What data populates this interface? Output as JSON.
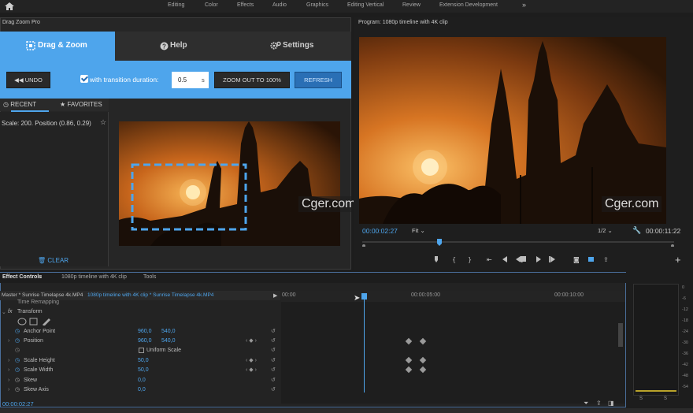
{
  "topbar": {
    "workspaces": [
      "Editing",
      "Color",
      "Effects",
      "Audio",
      "Graphics",
      "Editing Vertical",
      "Review",
      "Extension Development"
    ],
    "more": "»"
  },
  "plugin": {
    "title": "Drag Zoom Pro",
    "tabs": {
      "drag": "Drag & Zoom",
      "help": "Help",
      "settings": "Settings"
    },
    "undo_label": "UNDO",
    "transition_label": "with transition duration:",
    "duration_value": "0.5",
    "duration_unit": "s",
    "zoom_out_label": "ZOOM OUT TO 100%",
    "refresh_label": "REFRESH",
    "recent_tab": "RECENT",
    "favorites_tab": "FAVORITES",
    "history_item": "Scale: 200. Position (0.86, 0.29)",
    "clear_label": "CLEAR"
  },
  "program": {
    "title": "Program: 1080p timeline with 4K clip",
    "timecode_current": "00:00:02:27",
    "fit": "Fit",
    "resolution": "1/2",
    "timecode_total": "00:00:11:22",
    "add": "+"
  },
  "watermark": "Cger.com",
  "effects": {
    "tabs": [
      "Effect Controls",
      "1080p timeline with 4K clip",
      "Tools"
    ],
    "master_clip": "Master * Sunrise Timelapse 4k.MP4",
    "sequence_clip": "1080p timeline with 4K clip * Sunrise Timelapse 4k.MP4",
    "time_remapping": "Time Remapping",
    "transform": "Transform",
    "rows": [
      {
        "name": "Anchor Point",
        "v1": "960,0",
        "v2": "540,0"
      },
      {
        "name": "Position",
        "v1": "960,0",
        "v2": "540,0"
      },
      {
        "name": "Uniform Scale",
        "v1": "",
        "v2": ""
      },
      {
        "name": "Scale Height",
        "v1": "50,0",
        "v2": ""
      },
      {
        "name": "Scale Width",
        "v1": "50,0",
        "v2": ""
      },
      {
        "name": "Skew",
        "v1": "0,0",
        "v2": ""
      },
      {
        "name": "Skew Axis",
        "v1": "0,0",
        "v2": ""
      }
    ],
    "ruler": [
      "00:00",
      "00:00:05:00",
      "00:00:10:00"
    ],
    "current_time": "00:00:02:27"
  },
  "meter": {
    "ticks": [
      "0",
      "-6",
      "-12",
      "-18",
      "-24",
      "-30",
      "-36",
      "-42",
      "-48",
      "-54"
    ],
    "solo": [
      "S",
      "S"
    ]
  },
  "colors": {
    "accent": "#4ea5ec",
    "panel": "#232323",
    "sky_top": "#8a4a1a",
    "sky_glow": "#f08a2c"
  }
}
